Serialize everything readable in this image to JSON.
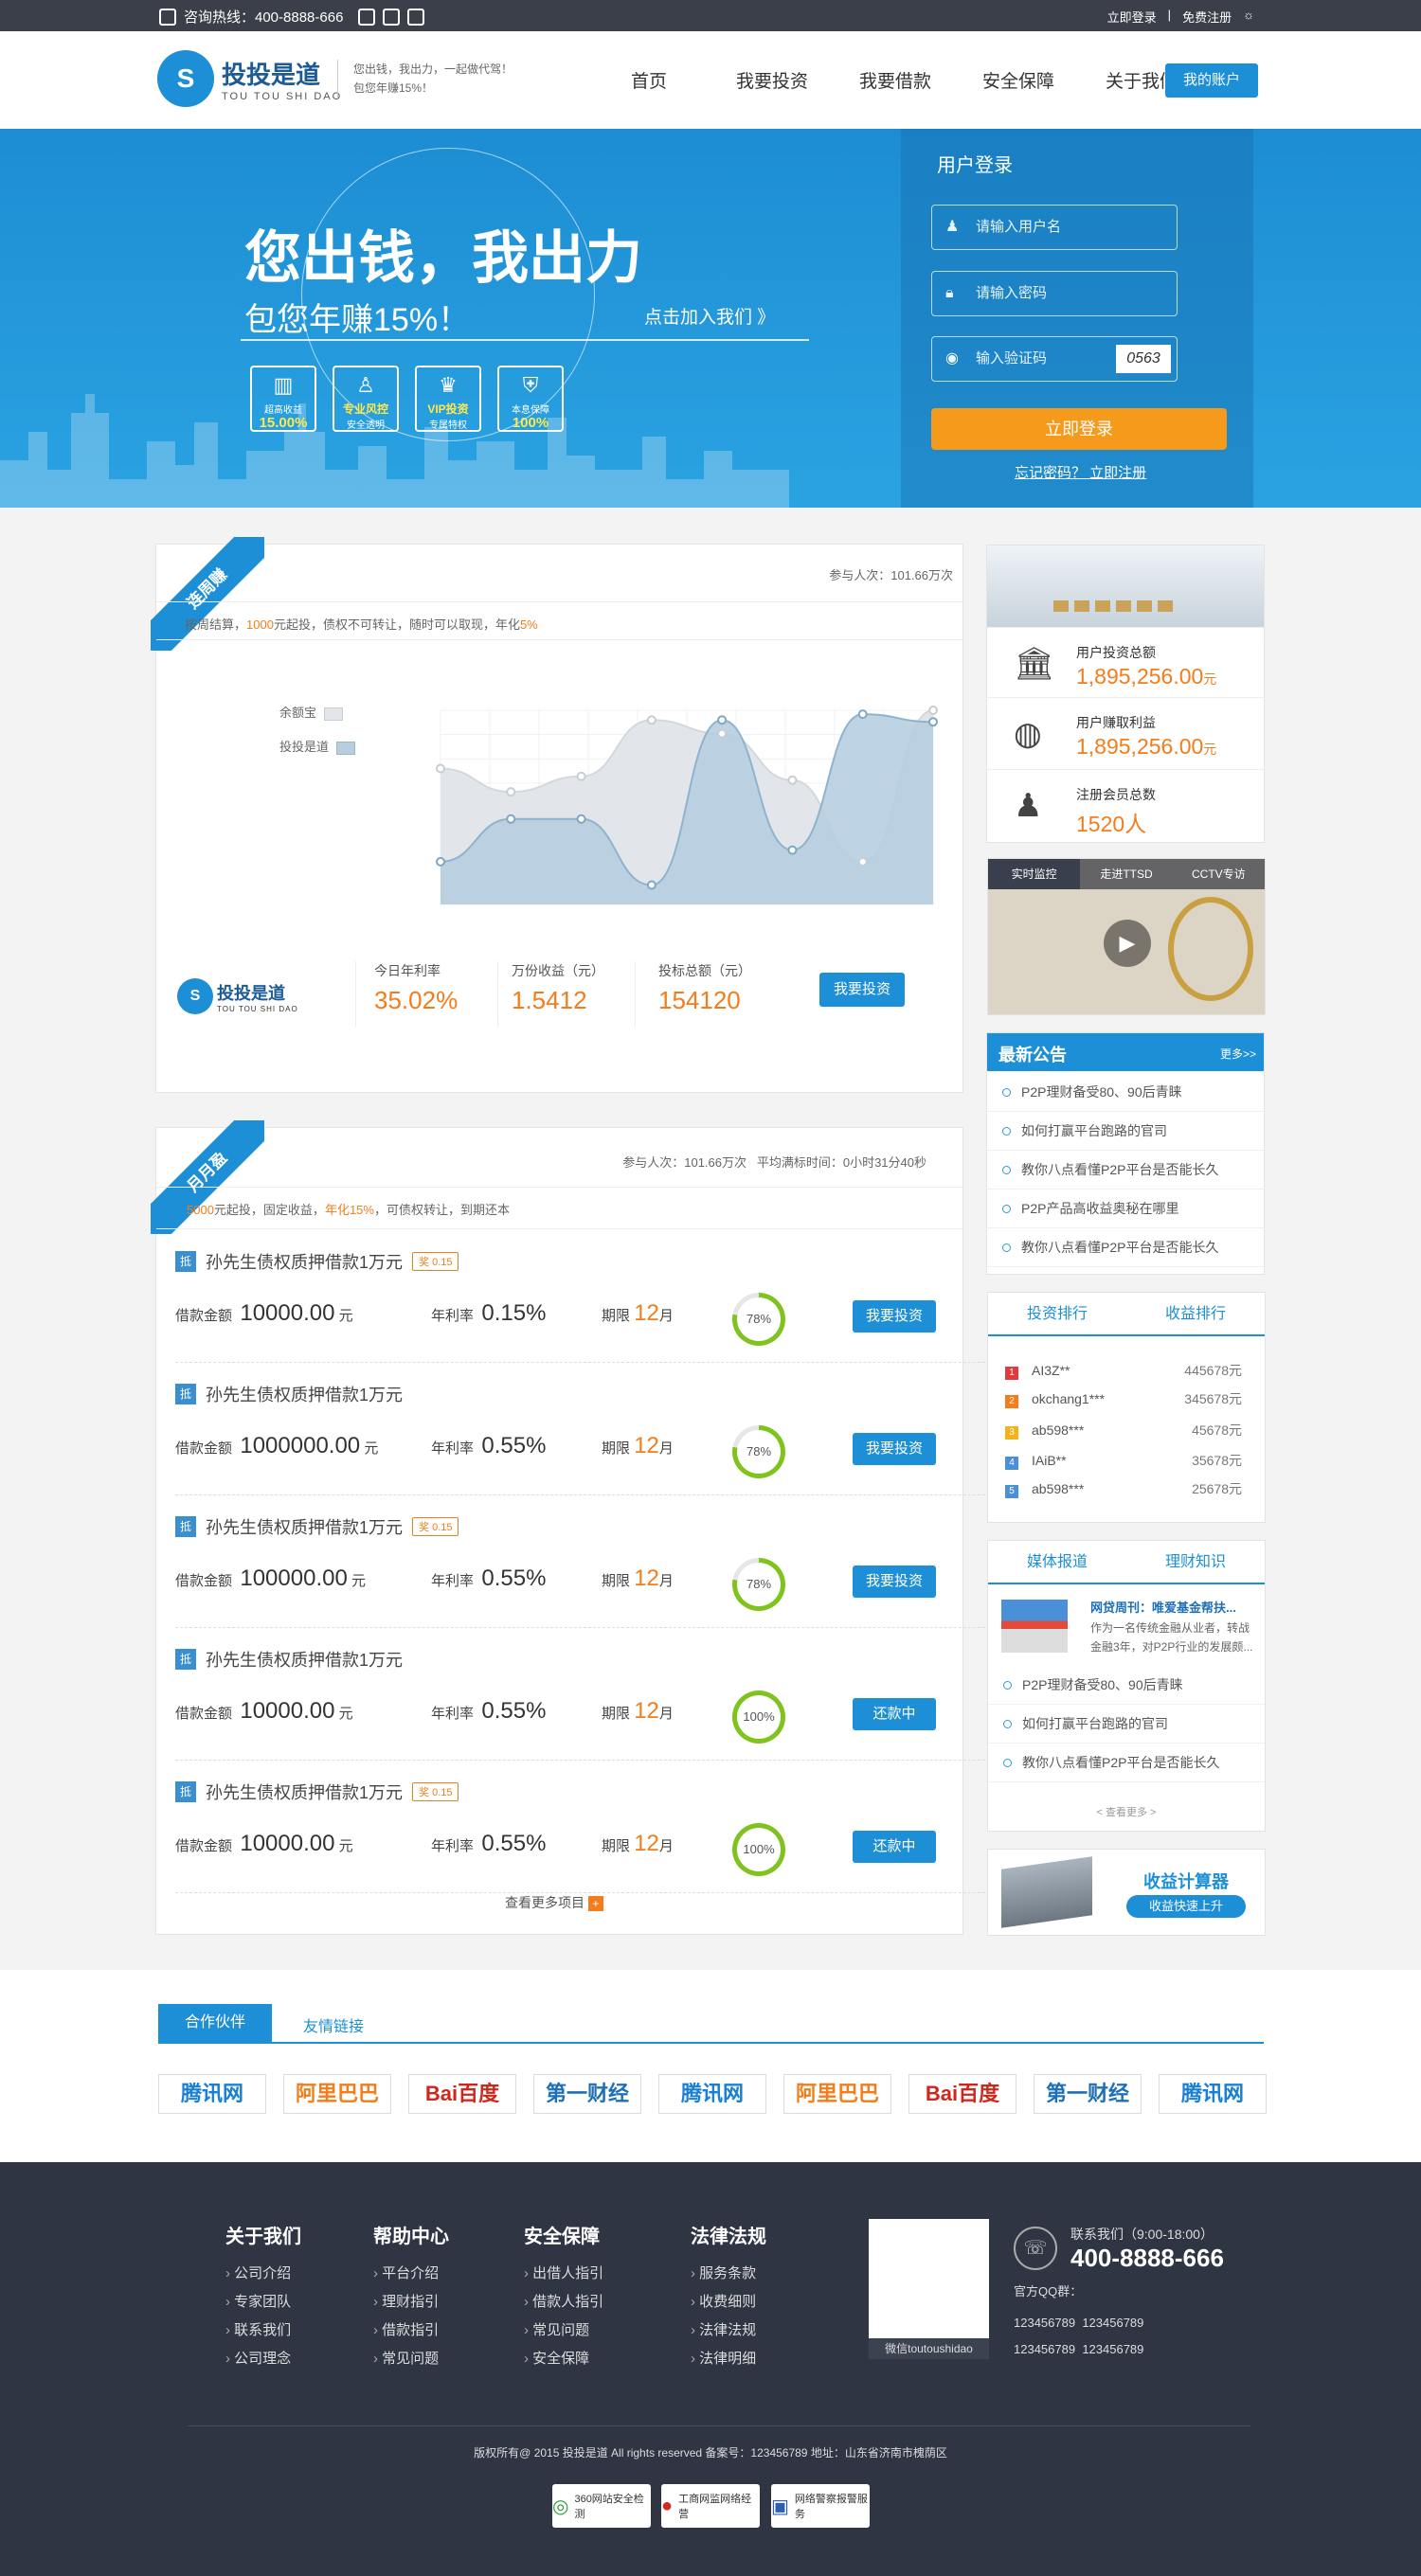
{
  "topbar": {
    "hotline": "咨询热线：400-8888-666",
    "login": "立即登录",
    "sep": "|",
    "register": "免费注册"
  },
  "header": {
    "logo_cn": "投投是道",
    "logo_en": "TOU TOU SHI DAO",
    "slogan_1": "您出钱，我出力，一起做代驾！",
    "slogan_2": "包您年赚15%！",
    "nav": [
      "首页",
      "我要投资",
      "我要借款",
      "安全保障",
      "关于我们"
    ],
    "account": "我的账户"
  },
  "banner": {
    "title": "您出钱，我出力",
    "subtitle": "包您年赚15%！",
    "join": "点击加入我们 》",
    "icons": [
      {
        "label": "超高收益",
        "value": "15.00%",
        "icon": "chart-icon"
      },
      {
        "label": "专业风控",
        "value": "安全透明",
        "icon": "user-tie-icon"
      },
      {
        "label": "VIP投资",
        "value": "专属特权",
        "icon": "vip-icon"
      },
      {
        "label": "本息保障",
        "value": "100%",
        "icon": "shield-icon"
      }
    ]
  },
  "login": {
    "title": "用户登录",
    "user_placeholder": "请输入用户名",
    "pwd_placeholder": "请输入密码",
    "code_placeholder": "输入验证码",
    "captcha": "0563",
    "submit": "立即登录",
    "forgot": "忘记密码？ 立即注册"
  },
  "weekly": {
    "ribbon": "连周赚",
    "participants": "参与人次：101.66万次",
    "desc_a": "按周结算，",
    "desc_b": "1000",
    "desc_c": "元起投，债权不可转让，随时可以取现，年化",
    "desc_d": "5%",
    "stats": [
      {
        "label": "今日年利率",
        "value": "35.02%"
      },
      {
        "label": "万份收益（元）",
        "value": "1.5412"
      },
      {
        "label": "投标总额（元）",
        "value": "154120"
      }
    ],
    "invest": "我要投资"
  },
  "chart_data": {
    "type": "area",
    "series": [
      {
        "name": "余额宝",
        "values": [
          70,
          58,
          66,
          95,
          88,
          64,
          22,
          100
        ],
        "color": "#e2e6ea"
      },
      {
        "name": "投投是道",
        "values": [
          22,
          44,
          44,
          10,
          95,
          28,
          98,
          94
        ],
        "color": "#b7cee0"
      }
    ],
    "x": [
      1,
      2,
      3,
      4,
      5,
      6,
      7,
      8
    ],
    "ylim": [
      0,
      100
    ]
  },
  "monthly": {
    "ribbon": "月月盈",
    "participants": "参与人次：101.66万次",
    "avg_time": "平均满标时间：0小时31分40秒",
    "desc_a": "5000",
    "desc_b": "元起投，固定收益，",
    "desc_c": "年化15%",
    "desc_d": "，可债权转让，到期还本",
    "loans": [
      {
        "tag": "抵",
        "title": "孙先生债权质押借款1万元",
        "bonus": "奖 0.15",
        "amount_label": "借款金额",
        "amount": "10000.00",
        "amount_unit": "元",
        "rate_label": "年利率",
        "rate": "0.15%",
        "term_label": "期限",
        "term": "12",
        "term_unit": "月",
        "progress": 78,
        "progress_text": "78%",
        "action": "我要投资"
      },
      {
        "tag": "抵",
        "title": "孙先生债权质押借款1万元",
        "bonus": "",
        "amount_label": "借款金额",
        "amount": "1000000.00",
        "amount_unit": "元",
        "rate_label": "年利率",
        "rate": "0.55%",
        "term_label": "期限",
        "term": "12",
        "term_unit": "月",
        "progress": 78,
        "progress_text": "78%",
        "action": "我要投资"
      },
      {
        "tag": "抵",
        "title": "孙先生债权质押借款1万元",
        "bonus": "奖 0.15",
        "amount_label": "借款金额",
        "amount": "100000.00",
        "amount_unit": "元",
        "rate_label": "年利率",
        "rate": "0.55%",
        "term_label": "期限",
        "term": "12",
        "term_unit": "月",
        "progress": 78,
        "progress_text": "78%",
        "action": "我要投资"
      },
      {
        "tag": "抵",
        "title": "孙先生债权质押借款1万元",
        "bonus": "",
        "amount_label": "借款金额",
        "amount": "10000.00",
        "amount_unit": "元",
        "rate_label": "年利率",
        "rate": "0.55%",
        "term_label": "期限",
        "term": "12",
        "term_unit": "月",
        "progress": 100,
        "progress_text": "100%",
        "action": "还款中"
      },
      {
        "tag": "抵",
        "title": "孙先生债权质押借款1万元",
        "bonus": "奖 0.15",
        "amount_label": "借款金额",
        "amount": "10000.00",
        "amount_unit": "元",
        "rate_label": "年利率",
        "rate": "0.55%",
        "term_label": "期限",
        "term": "12",
        "term_unit": "月",
        "progress": 100,
        "progress_text": "100%",
        "action": "还款中"
      }
    ],
    "more": "查看更多项目"
  },
  "side": {
    "totals": [
      {
        "icon": "bank-icon",
        "label": "用户投资总额",
        "value": "1,895,256.00",
        "unit": "元"
      },
      {
        "icon": "globe-icon",
        "label": "用户赚取利益",
        "value": "1,895,256.00",
        "unit": "元"
      },
      {
        "icon": "user-icon",
        "label": "注册会员总数",
        "value": "1520人",
        "unit": ""
      }
    ],
    "video_tabs": [
      "实时监控",
      "走进TTSD",
      "CCTV专访"
    ],
    "notice_title": "最新公告",
    "notice_more": "更多>>",
    "notices": [
      "P2P理财备受80、90后青睐",
      "如何打赢平台跑路的官司",
      "教你八点看懂P2P平台是否能长久",
      "P2P产品高收益奥秘在哪里",
      "教你八点看懂P2P平台是否能长久"
    ],
    "rank_tabs": [
      "投资排行",
      "收益排行"
    ],
    "ranks": [
      {
        "n": "1",
        "name": "AI3Z**",
        "v": "445678元"
      },
      {
        "n": "2",
        "name": "okchang1***",
        "v": "345678元"
      },
      {
        "n": "3",
        "name": "ab598***",
        "v": "45678元"
      },
      {
        "n": "4",
        "name": "IAiB**",
        "v": "35678元"
      },
      {
        "n": "5",
        "name": "ab598***",
        "v": "25678元"
      }
    ],
    "media_tabs": [
      "媒体报道",
      "理财知识"
    ],
    "media_headline": "网贷周刊：唯爱基金帮扶...",
    "media_text": "作为一名传统金融从业者，转战金融3年，对P2P行业的发展颇...",
    "media_list": [
      "P2P理财备受80、90后青睐",
      "如何打赢平台跑路的官司",
      "教你八点看懂P2P平台是否能长久"
    ],
    "media_more": "< 查看更多 >",
    "calc_title": "收益计算器",
    "calc_btn": "收益快速上升"
  },
  "partners": {
    "tabs": [
      "合作伙伴",
      "友情链接"
    ],
    "logos": [
      "腾讯网",
      "阿里巴巴",
      "Bai百度",
      "第一财经",
      "腾讯网",
      "阿里巴巴",
      "Bai百度",
      "第一财经",
      "腾讯网"
    ]
  },
  "footer": {
    "cols": [
      {
        "title": "关于我们",
        "items": [
          "公司介绍",
          "专家团队",
          "联系我们",
          "公司理念"
        ]
      },
      {
        "title": "帮助中心",
        "items": [
          "平台介绍",
          "理财指引",
          "借款指引",
          "常见问题"
        ]
      },
      {
        "title": "安全保障",
        "items": [
          "出借人指引",
          "借款人指引",
          "常见问题",
          "安全保障"
        ]
      },
      {
        "title": "法律法规",
        "items": [
          "服务条款",
          "收费细则",
          "法律法规",
          "法律明细"
        ]
      }
    ],
    "qr_caption": "微信toutoushidao",
    "contact_label": "联系我们（9:00-18:00）",
    "phone": "400-8888-666",
    "qq_label": "官方QQ群：",
    "qq": [
      "123456789",
      "123456789",
      "123456789",
      "123456789"
    ],
    "copyright": "版权所有@ 2015 投投是道 All rights reserved  备案号：123456789   地址：山东省济南市槐荫区",
    "badges": [
      "360网站安全检测",
      "工商网监网络经营",
      "网络警察报警服务"
    ]
  }
}
